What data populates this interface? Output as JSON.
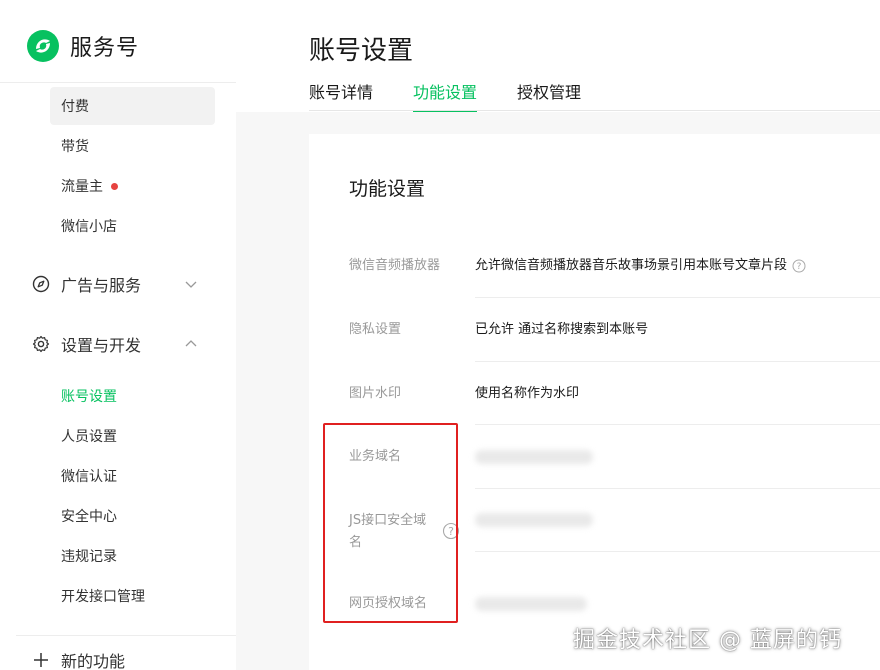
{
  "brand": {
    "name": "服务号",
    "logo_icon": "wechat-service-logo-icon",
    "color": "#07c160"
  },
  "sidebar": {
    "top_items": [
      {
        "label": "付费"
      },
      {
        "label": "带货"
      },
      {
        "label": "流量主",
        "badge": "red-dot"
      },
      {
        "label": "微信小店"
      }
    ],
    "groups": [
      {
        "label": "广告与服务",
        "icon": "compass-icon",
        "expanded": false
      },
      {
        "label": "设置与开发",
        "icon": "gear-icon",
        "expanded": true
      }
    ],
    "settings_items": [
      {
        "label": "账号设置",
        "selected": true
      },
      {
        "label": "人员设置"
      },
      {
        "label": "微信认证"
      },
      {
        "label": "安全中心"
      },
      {
        "label": "违规记录"
      },
      {
        "label": "开发接口管理"
      }
    ],
    "new_feature": {
      "label": "新的功能",
      "icon": "plus-icon"
    }
  },
  "main": {
    "page_title": "账号设置",
    "tabs": [
      {
        "label": "账号详情"
      },
      {
        "label": "功能设置",
        "active": true
      },
      {
        "label": "授权管理"
      }
    ],
    "card": {
      "title": "功能设置",
      "rows": [
        {
          "label": "微信音频播放器",
          "value": "允许微信音频播放器音乐故事场景引用本账号文章片段",
          "help_icon": true
        },
        {
          "label": "隐私设置",
          "value": "已允许 通过名称搜索到本账号"
        },
        {
          "label": "图片水印",
          "value": "使用名称作为水印"
        },
        {
          "label": "业务域名",
          "value_blurred": true
        },
        {
          "label": "JS接口安全域名",
          "value_blurred": true,
          "label_help_icon": true
        },
        {
          "label": "网页授权域名",
          "value_blurred": true
        }
      ]
    }
  },
  "overlay": {
    "watermark": "掘金技术社区 @ 蓝屏的钙",
    "highlight_color": "#e02020"
  },
  "colors": {
    "accent": "#07c160",
    "muted": "#999999",
    "badge": "#e64340"
  }
}
